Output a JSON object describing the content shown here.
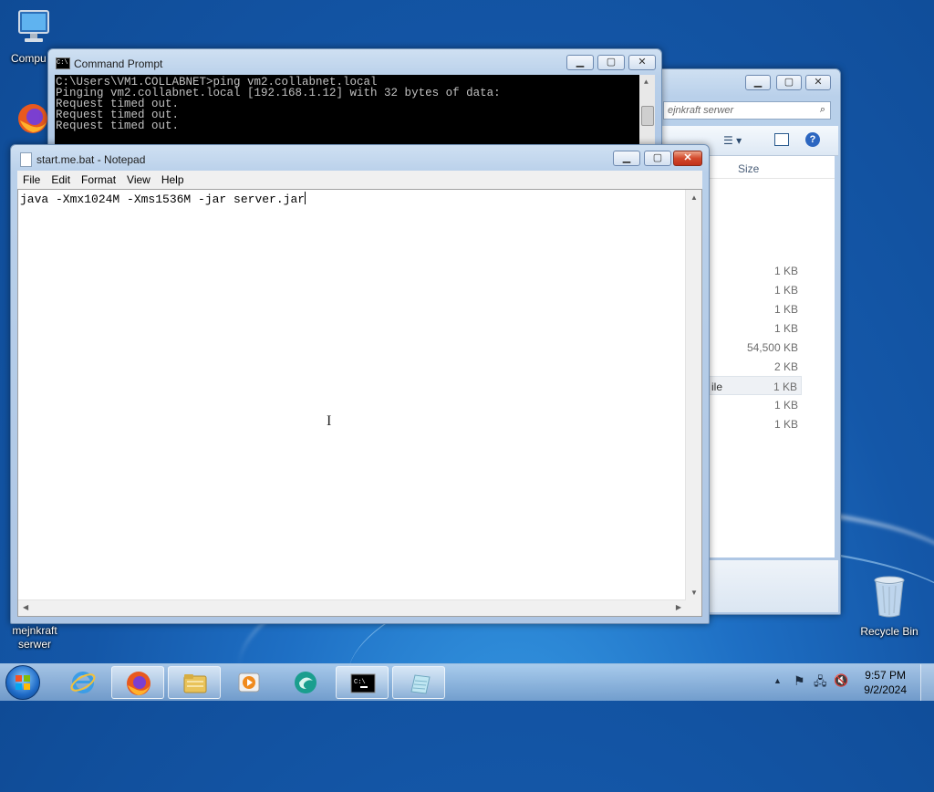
{
  "desktop": {
    "icons": [
      {
        "label": "Compu"
      },
      {
        "label": "mejnkraft serwer"
      },
      {
        "label": "Recycle Bin"
      }
    ]
  },
  "cmd_window": {
    "title": "Command Prompt",
    "lines": [
      "C:\\Users\\VM1.COLLABNET>ping vm2.collabnet.local",
      "",
      "Pinging vm2.collabnet.local [192.168.1.12] with 32 bytes of data:",
      "Request timed out.",
      "Request timed out.",
      "Request timed out."
    ]
  },
  "explorer_window": {
    "search_placeholder": "ejnkraft serwer",
    "size_header": "Size",
    "rows": [
      {
        "name": "",
        "size": "1 KB"
      },
      {
        "name": "",
        "size": "1 KB"
      },
      {
        "name": "",
        "size": "1 KB"
      },
      {
        "name": "",
        "size": "1 KB"
      },
      {
        "name": "",
        "size": "54,500 KB"
      },
      {
        "name": "",
        "size": "2 KB"
      },
      {
        "name": "ile",
        "size": "1 KB"
      },
      {
        "name": "",
        "size": "1 KB"
      },
      {
        "name": "",
        "size": "1 KB"
      }
    ]
  },
  "notepad_window": {
    "title": "start.me.bat - Notepad",
    "menu": [
      "File",
      "Edit",
      "Format",
      "View",
      "Help"
    ],
    "content": "java -Xmx1024M -Xms1536M -jar server.jar"
  },
  "taskbar": {
    "time": "9:57 PM",
    "date": "9/2/2024"
  },
  "colors": {
    "desktop": "#1e6fc4",
    "close_button": "#c0311b"
  }
}
